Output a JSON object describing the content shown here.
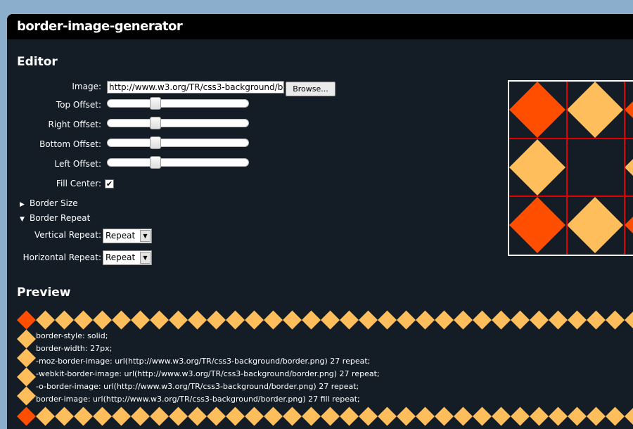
{
  "app": {
    "title": "border-image-generator"
  },
  "editor": {
    "heading": "Editor",
    "image_label": "Image:",
    "image_value": "http://www.w3.org/TR/css3-background/border.png",
    "browse_label": "Browse...",
    "top_offset_label": "Top Offset:",
    "right_offset_label": "Right Offset:",
    "bottom_offset_label": "Bottom Offset:",
    "left_offset_label": "Left Offset:",
    "fill_center_label": "Fill Center:",
    "fill_center_checked": true,
    "border_size_label": "Border Size",
    "border_repeat_label": "Border Repeat",
    "vertical_repeat_label": "Vertical Repeat:",
    "vertical_repeat_value": "Repeat",
    "horizontal_repeat_label": "Horizontal Repeat:",
    "horizontal_repeat_value": "Repeat"
  },
  "preview": {
    "heading": "Preview",
    "css_lines": [
      "border-style: solid;",
      "border-width: 27px;",
      "-moz-border-image: url(http://www.w3.org/TR/css3-background/border.png) 27 repeat;",
      "-webkit-border-image: url(http://www.w3.org/TR/css3-background/border.png) 27 repeat;",
      "-o-border-image: url(http://www.w3.org/TR/css3-background/border.png) 27 repeat;",
      "border-image: url(http://www.w3.org/TR/css3-background/border.png) 27 fill repeat;"
    ]
  },
  "colors": {
    "corner": "#ff4e00",
    "edge": "#ffbe5c",
    "guide": "#e00000",
    "background": "#141d26"
  }
}
